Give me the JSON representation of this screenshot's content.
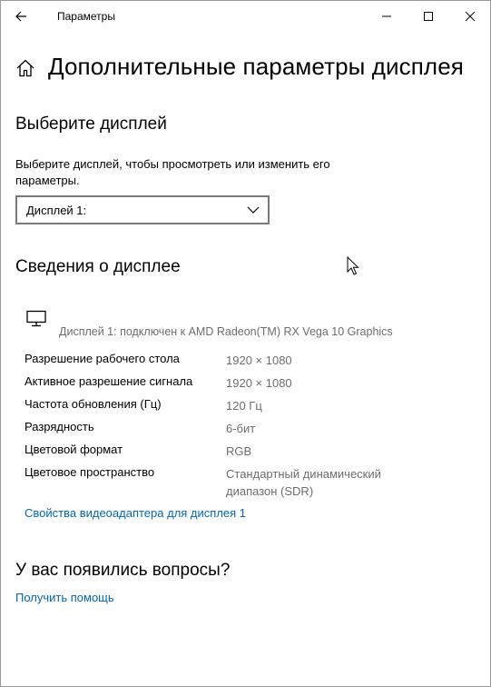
{
  "window": {
    "title": "Параметры"
  },
  "page": {
    "title": "Дополнительные параметры дисплея"
  },
  "select_display": {
    "heading": "Выберите дисплей",
    "description": "Выберите дисплей, чтобы просмотреть или изменить его параметры.",
    "dropdown_value": "Дисплей 1:"
  },
  "display_info": {
    "heading": "Сведения о дисплее",
    "caption": "Дисплей 1: подключен к AMD Radeon(TM) RX Vega 10 Graphics",
    "rows": [
      {
        "label": "Разрешение рабочего стола",
        "value": "1920 × 1080"
      },
      {
        "label": "Активное разрешение сигнала",
        "value": "1920 × 1080"
      },
      {
        "label": "Частота обновления (Гц)",
        "value": "120 Гц"
      },
      {
        "label": "Разрядность",
        "value": "6-бит"
      },
      {
        "label": "Цветовой формат",
        "value": "RGB"
      },
      {
        "label": "Цветовое пространство",
        "value": "Стандартный динамический диапазон (SDR)"
      }
    ],
    "adapter_link": "Свойства видеоадаптера для дисплея 1"
  },
  "questions": {
    "heading": "У вас появились вопросы?",
    "help_link": "Получить помощь"
  },
  "colors": {
    "link": "#0067b8",
    "secondary_text": "#6d6d6d"
  },
  "icons": [
    "back-arrow-icon",
    "minimize-icon",
    "maximize-icon",
    "close-icon",
    "home-icon",
    "chevron-down-icon",
    "monitor-icon",
    "mouse-pointer-icon"
  ]
}
